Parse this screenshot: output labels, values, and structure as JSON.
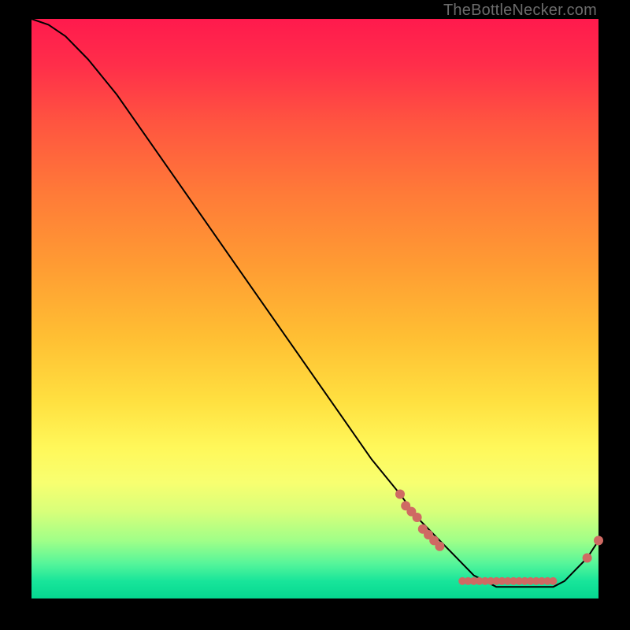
{
  "watermark": "TheBottleNecker.com",
  "chart_data": {
    "type": "line",
    "title": "",
    "xlabel": "",
    "ylabel": "",
    "xlim": [
      0,
      100
    ],
    "ylim": [
      0,
      100
    ],
    "grid": false,
    "legend": false,
    "series": [
      {
        "name": "curve",
        "x": [
          0,
          3,
          6,
          10,
          15,
          20,
          25,
          30,
          35,
          40,
          45,
          50,
          55,
          60,
          65,
          68,
          70,
          72,
          74,
          76,
          78,
          80,
          82,
          84,
          86,
          88,
          90,
          92,
          94,
          96,
          98,
          100
        ],
        "y": [
          100,
          99,
          97,
          93,
          87,
          80,
          73,
          66,
          59,
          52,
          45,
          38,
          31,
          24,
          18,
          14,
          12,
          10,
          8,
          6,
          4,
          3,
          2,
          2,
          2,
          2,
          2,
          2,
          3,
          5,
          7,
          10
        ],
        "color": "#000000",
        "width": 2
      }
    ],
    "markers": [
      {
        "name": "cluster-descending",
        "color": "#cf6a63",
        "radius": 6,
        "points": [
          {
            "x": 65,
            "y": 18
          },
          {
            "x": 66,
            "y": 16
          },
          {
            "x": 67,
            "y": 15
          },
          {
            "x": 68,
            "y": 14
          },
          {
            "x": 69,
            "y": 12
          },
          {
            "x": 70,
            "y": 11
          },
          {
            "x": 71,
            "y": 10
          },
          {
            "x": 72,
            "y": 9
          }
        ]
      },
      {
        "name": "cluster-bottom",
        "color": "#cf6a63",
        "radius": 5,
        "points": [
          {
            "x": 76,
            "y": 3
          },
          {
            "x": 77,
            "y": 3
          },
          {
            "x": 78,
            "y": 3
          },
          {
            "x": 79,
            "y": 3
          },
          {
            "x": 80,
            "y": 3
          },
          {
            "x": 81,
            "y": 3
          },
          {
            "x": 82,
            "y": 3
          },
          {
            "x": 83,
            "y": 3
          },
          {
            "x": 84,
            "y": 3
          },
          {
            "x": 85,
            "y": 3
          },
          {
            "x": 86,
            "y": 3
          },
          {
            "x": 87,
            "y": 3
          },
          {
            "x": 88,
            "y": 3
          },
          {
            "x": 89,
            "y": 3
          },
          {
            "x": 90,
            "y": 3
          },
          {
            "x": 91,
            "y": 3
          },
          {
            "x": 92,
            "y": 3
          }
        ]
      },
      {
        "name": "cluster-rising",
        "color": "#cf6a63",
        "radius": 6,
        "points": [
          {
            "x": 98,
            "y": 7
          },
          {
            "x": 100,
            "y": 10
          }
        ]
      }
    ]
  }
}
